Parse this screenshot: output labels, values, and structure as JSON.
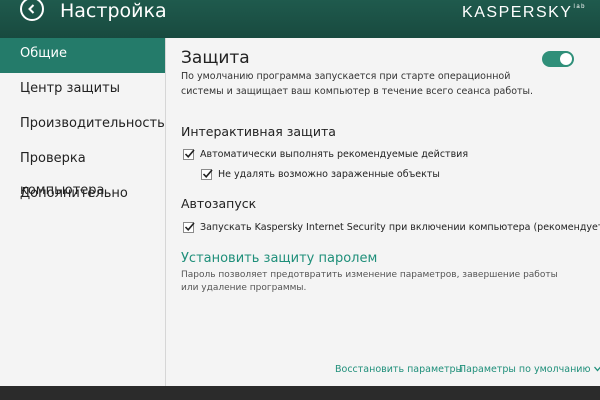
{
  "header": {
    "title": "Настройка",
    "logo_main": "KASPERSKY",
    "logo_sub": "lab"
  },
  "sidebar": {
    "items": [
      {
        "label": "Общие",
        "active": true
      },
      {
        "label": "Центр защиты"
      },
      {
        "label": "Производительность"
      },
      {
        "label": "Проверка компьютера"
      },
      {
        "label": "Дополнительно"
      }
    ]
  },
  "main": {
    "title": "Защита",
    "toggle_on": true,
    "description": "По умолчанию программа запускается при старте операционной системы и защищает ваш компьютер в течение всего сеанса работы.",
    "interactive": {
      "heading": "Интерактивная защита",
      "options": [
        {
          "label": "Автоматически выполнять рекомендуемые действия",
          "checked": true
        },
        {
          "label": "Не удалять возможно зараженные объекты",
          "checked": true
        }
      ]
    },
    "autorun": {
      "heading": "Автозапуск",
      "option": {
        "label": "Запускать Kaspersky Internet Security при включении компьютера (рекомендуется)",
        "checked": true
      }
    },
    "password": {
      "link": "Установить защиту паролем",
      "description": "Пароль позволяет предотвратить изменение параметров, завершение работы или удаление программы."
    },
    "footer": {
      "restore": "Восстановить параметры",
      "defaults": "Параметры по умолчанию"
    }
  },
  "colors": {
    "accent": "#247b6a",
    "link": "#1f8f7a",
    "header": "#1f5a4d"
  }
}
